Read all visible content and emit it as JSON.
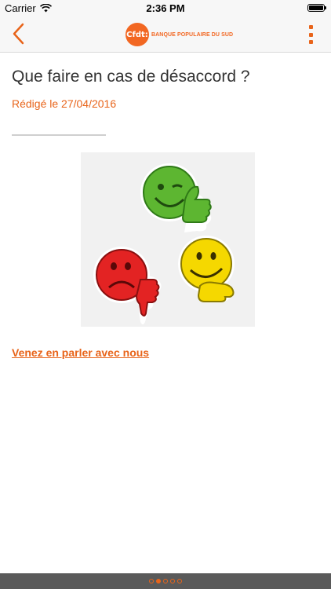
{
  "status_bar": {
    "carrier": "Carrier",
    "time": "2:36 PM"
  },
  "navbar": {
    "logo_mark": "Cfdt:",
    "logo_text": "BANQUE POPULAIRE DU SUD",
    "back_icon": "chevron-left-icon",
    "menu_icon": "more-vertical-icon"
  },
  "article": {
    "title": "Que faire en cas de désaccord ?",
    "date": "Rédigé le 27/04/2016",
    "link_label": "Venez en parler avec nous"
  },
  "pager": {
    "count": 5,
    "active_index": 1
  },
  "colors": {
    "accent": "#e8641a",
    "bar": "#f7f7f7",
    "bottom_bar": "#5a5a5a"
  }
}
